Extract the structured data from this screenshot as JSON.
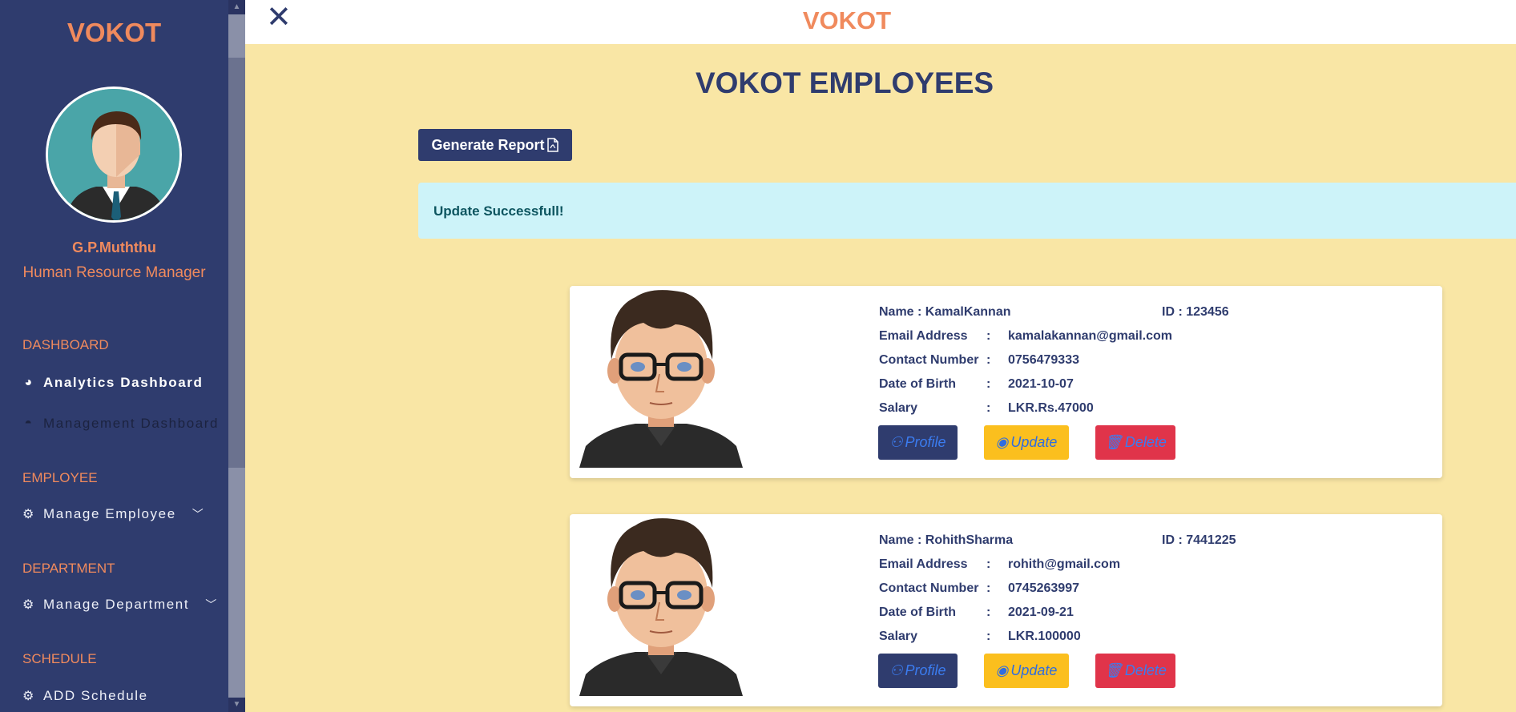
{
  "sidebar": {
    "brand": "VOKOT",
    "user_name": "G.P.Muththu",
    "user_role": "Human Resource Manager",
    "sections": {
      "dashboard": "DASHBOARD",
      "employee": "EMPLOYEE",
      "department": "DEPARTMENT",
      "schedule": "SCHEDULE"
    },
    "items": {
      "analytics": "Analytics Dashboard",
      "management": "Management Dashboard",
      "manage_employee": "Manage Employee",
      "manage_department": "Manage Department",
      "add_schedule": "ADD Schedule"
    }
  },
  "topbar": {
    "close": "✕",
    "title": "VOKOT"
  },
  "main": {
    "page_title": "VOKOT EMPLOYEES",
    "report_button": "Generate Report",
    "alert": "Update Successfull!"
  },
  "labels": {
    "email": "Email Address",
    "contact": "Contact Number",
    "dob": "Date of Birth",
    "salary": "Salary",
    "colon": ":",
    "profile": "Profile",
    "update": "Update",
    "delete": "Delete"
  },
  "employees": [
    {
      "name": "Name : KamalKannan",
      "id": "ID : 123456",
      "email": "kamalakannan@gmail.com",
      "contact": "0756479333",
      "dob": "2021-10-07",
      "salary": "LKR.Rs.47000"
    },
    {
      "name": "Name : RohithSharma",
      "id": "ID : 7441225",
      "email": "rohith@gmail.com",
      "contact": "0745263997",
      "dob": "2021-09-21",
      "salary": "LKR.100000"
    }
  ],
  "colors": {
    "sidebar": "#2f3c6e",
    "accent": "#f08a5d",
    "background": "#f9e6a5",
    "alert_bg": "#cdf3f9",
    "update": "#fbbf1e",
    "delete": "#e0344a"
  }
}
